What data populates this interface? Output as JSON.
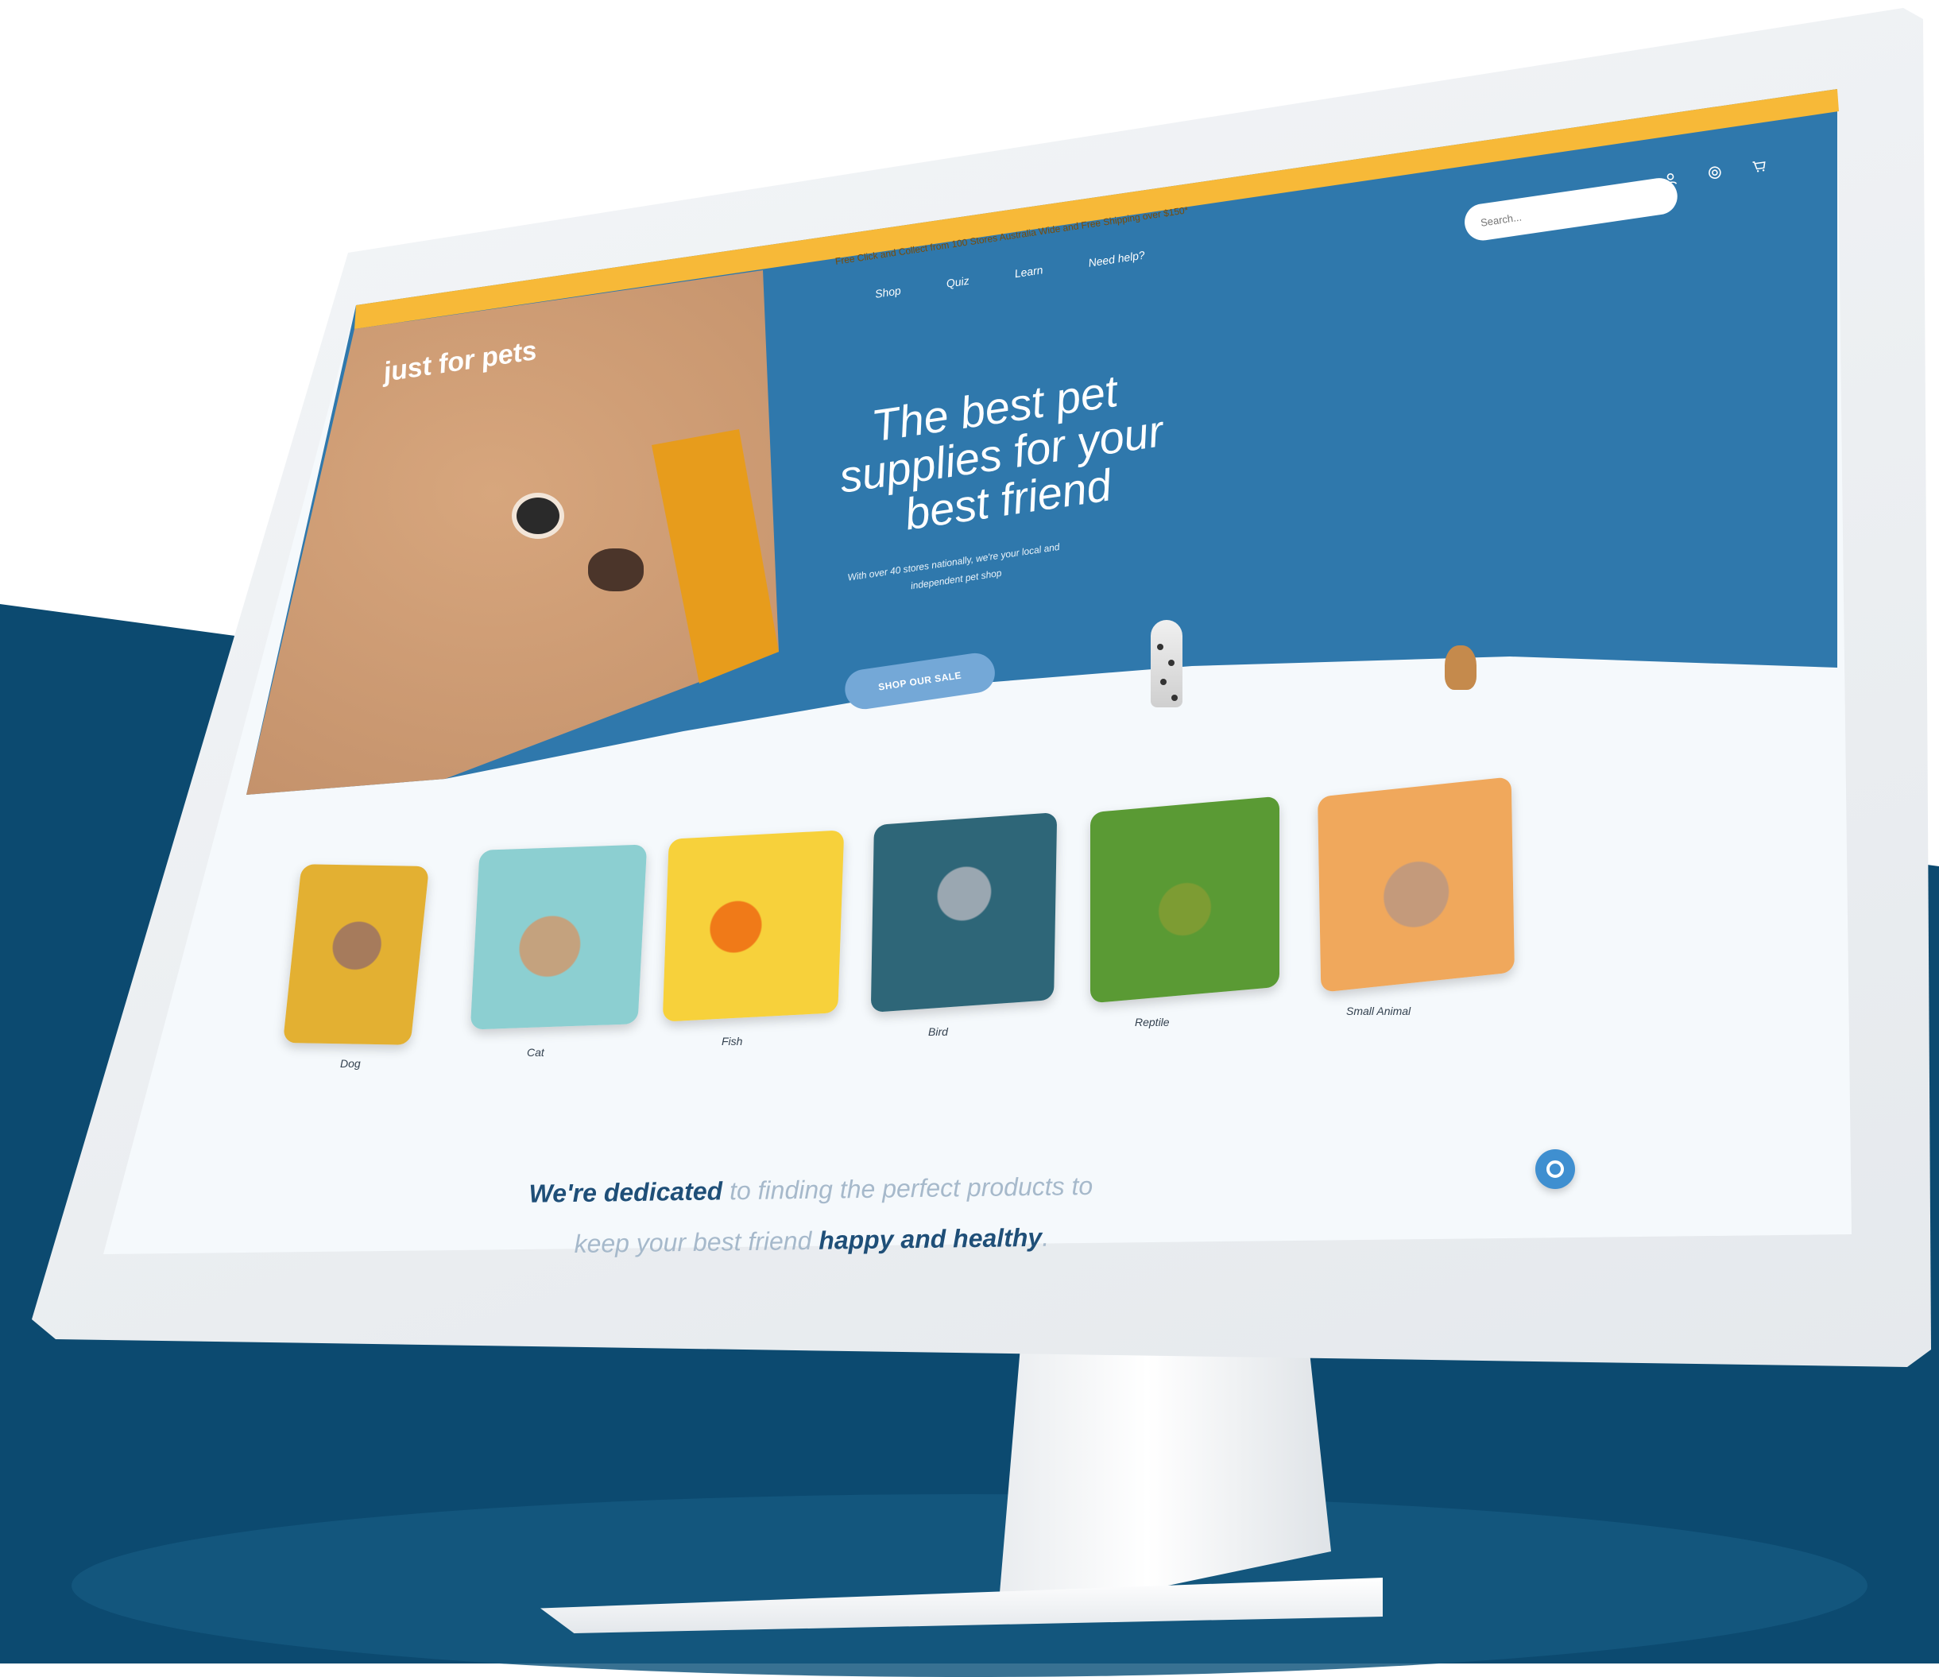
{
  "colors": {
    "background_band": "#0c4a70",
    "hero_blue": "#2f78ac",
    "promo_yellow": "#f7b938",
    "button_blue": "#74a8d7",
    "text_dark": "#1f4f78",
    "text_muted": "#a6b9cb"
  },
  "promo_bar": {
    "text": "Free Click and Collect from 100 Stores Australia Wide and Free Shipping over $150*"
  },
  "header": {
    "brand": "just for pets",
    "nav": [
      "Shop",
      "Quiz",
      "Learn",
      "Need help?"
    ],
    "search_placeholder": "Search...",
    "icons": [
      "user-icon",
      "rewards-icon",
      "cart-icon"
    ]
  },
  "hero": {
    "headline": "The best pet supplies for your best friend",
    "subline": "With over 40 stores nationally, we're your local and independent pet shop",
    "cta": "SHOP OUR SALE"
  },
  "categories": [
    "Dog",
    "Cat",
    "Fish",
    "Bird",
    "Reptile",
    "Small Animal"
  ],
  "mission": {
    "part1": "We're dedicated",
    "part2": " to finding the perfect products to keep your best friend ",
    "part3": "happy and healthy",
    "part4": "."
  },
  "chat_icon": "chat-bubble-icon"
}
